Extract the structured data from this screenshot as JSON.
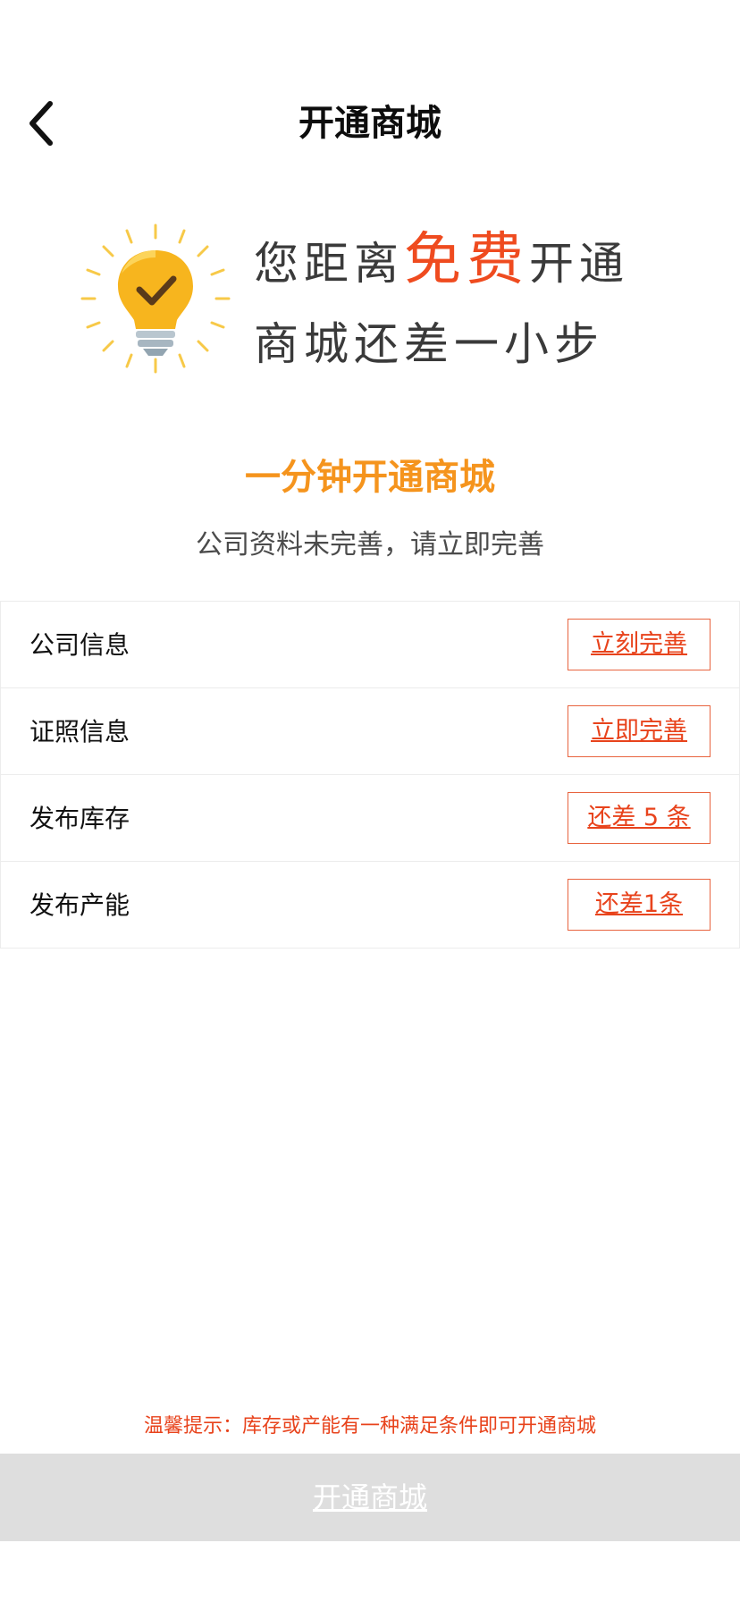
{
  "nav": {
    "title": "开通商城",
    "back_icon": "chevron-left-icon"
  },
  "banner": {
    "icon": "lightbulb-check-icon",
    "line1_prefix": "您距离",
    "line1_highlight": "免费",
    "line1_suffix": "开通",
    "line2": "商城还差一小步",
    "highlight_color": "#ef4b1f"
  },
  "section": {
    "title": "一分钟开通商城",
    "subtitle": "公司资料未完善，请立即完善",
    "title_color": "#f5941d"
  },
  "items": [
    {
      "label": "公司信息",
      "action": "立刻完善"
    },
    {
      "label": "证照信息",
      "action": "立即完善"
    },
    {
      "label": "发布库存",
      "action": "还差 5 条"
    },
    {
      "label": "发布产能",
      "action": "还差1条"
    }
  ],
  "tip": "温馨提示：库存或产能有一种满足条件即可开通商城",
  "open_button": "开通商城",
  "colors": {
    "accent_red": "#e8431c",
    "button_disabled_bg": "#dedede"
  }
}
